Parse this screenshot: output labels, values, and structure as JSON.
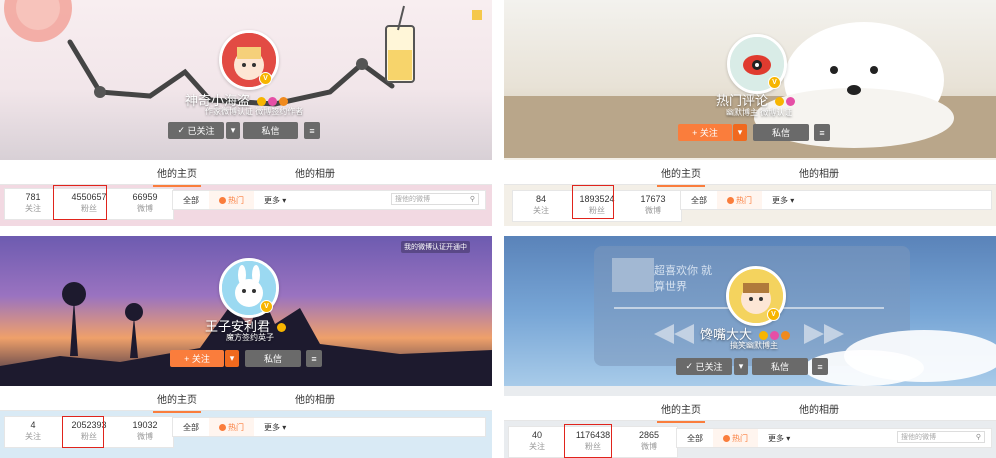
{
  "panels": [
    {
      "name": "神奇小海盗",
      "sub": "作家微博认证 微博签约作者",
      "follow_label": "已关注",
      "message_label": "私信",
      "tabs": [
        "他的主页",
        "他的相册"
      ],
      "stats": {
        "following": "781",
        "following_label": "关注",
        "followers": "4550657",
        "followers_label": "粉丝",
        "weibo": "66959",
        "weibo_label": "微博"
      },
      "feed": {
        "all": "全部",
        "hot": "热门",
        "more": "更多",
        "search_placeholder": "搜他的微博"
      }
    },
    {
      "name": "热门评论",
      "sub": "幽默博主 微博认证",
      "follow_label": "关注",
      "message_label": "私信",
      "tabs": [
        "他的主页",
        "他的相册"
      ],
      "stats": {
        "following": "84",
        "following_label": "关注",
        "followers": "1893524",
        "followers_label": "粉丝",
        "weibo": "17673",
        "weibo_label": "微博"
      },
      "feed": {
        "all": "全部",
        "hot": "热门",
        "more": "更多"
      }
    },
    {
      "name": "王子安利君",
      "sub": "魔方签约英子",
      "follow_label": "关注",
      "message_label": "私信",
      "tabs": [
        "他的主页",
        "他的相册"
      ],
      "cover_badge": "我的微博认证开通中",
      "stats": {
        "following": "4",
        "following_label": "关注",
        "followers": "2052393",
        "followers_label": "粉丝",
        "weibo": "19032",
        "weibo_label": "微博"
      },
      "feed": {
        "all": "全部",
        "hot": "热门",
        "more": "更多"
      }
    },
    {
      "name": "馋嘴大大",
      "sub": "搞笑幽默博主",
      "follow_label": "已关注",
      "message_label": "私信",
      "tabs": [
        "他的主页",
        "他的相册"
      ],
      "stats": {
        "following": "40",
        "following_label": "关注",
        "followers": "1176438",
        "followers_label": "粉丝",
        "weibo": "2865",
        "weibo_label": "微博"
      },
      "feed": {
        "all": "全部",
        "hot": "热门",
        "more": "更多",
        "search_placeholder": "搜他的微博"
      },
      "cover_text": "超喜欢你 就算世界"
    }
  ],
  "colors": {
    "accent": "#fa7d3c",
    "highlight_box": "#e0241c",
    "vip_badge": "#f7b500"
  }
}
